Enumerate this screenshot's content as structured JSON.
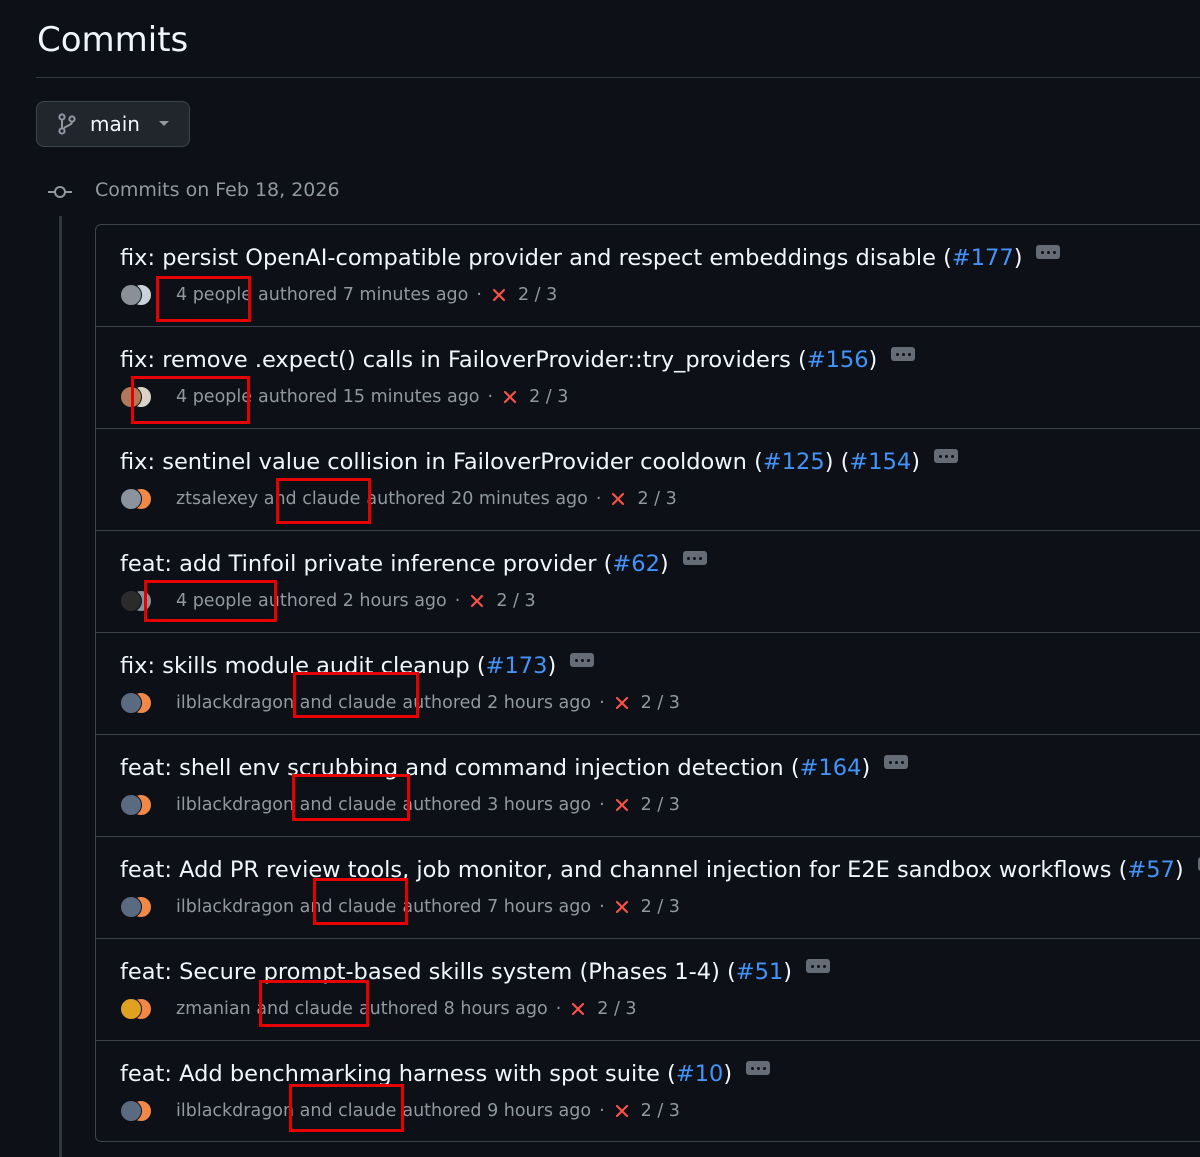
{
  "page": {
    "title": "Commits"
  },
  "branch": {
    "label": "main",
    "icon": "git-branch-icon"
  },
  "group": {
    "heading": "Commits on Feb 18, 2026"
  },
  "colors": {
    "background": "#0d1117",
    "link": "#4493f8",
    "muted": "#9198a1",
    "fail": "#f85149",
    "annotation": "#e60000"
  },
  "commits": [
    {
      "title_pre": "fix: persist OpenAI-compatible provider and respect embeddings disable (",
      "links": [
        "#177"
      ],
      "title_post": ")",
      "authors_text": "4 people",
      "authored": "authored 7 minutes ago",
      "status": "2 / 3"
    },
    {
      "title_pre": "fix: remove .expect() calls in FailoverProvider::try_providers (",
      "links": [
        "#156"
      ],
      "title_post": ")",
      "authors_text": "4 people",
      "authored": "authored 15 minutes ago",
      "status": "2 / 3"
    },
    {
      "title_pre": "fix: sentinel value collision in FailoverProvider cooldown (",
      "links": [
        "#125",
        "#154"
      ],
      "link_separator": ") (",
      "title_post": ")",
      "authors_text": "ztsalexey and claude",
      "authored": "authored 20 minutes ago",
      "status": "2 / 3"
    },
    {
      "title_pre": "feat: add Tinfoil private inference provider (",
      "links": [
        "#62"
      ],
      "title_post": ")",
      "authors_text": "4 people",
      "authored": "authored 2 hours ago",
      "status": "2 / 3"
    },
    {
      "title_pre": "fix: skills module audit cleanup (",
      "links": [
        "#173"
      ],
      "title_post": ")",
      "authors_text": "ilblackdragon and claude",
      "authored": "authored 2 hours ago",
      "status": "2 / 3"
    },
    {
      "title_pre": "feat: shell env scrubbing and command injection detection (",
      "links": [
        "#164"
      ],
      "title_post": ")",
      "authors_text": "ilblackdragon and claude",
      "authored": "authored 3 hours ago",
      "status": "2 / 3"
    },
    {
      "title_pre": "feat: Add PR review tools, job monitor, and channel injection for E2E sandbox workflows (",
      "links": [
        "#57"
      ],
      "title_post": ")",
      "authors_text": "ilblackdragon and claude",
      "authored": "authored 7 hours ago",
      "status": "2 / 3"
    },
    {
      "title_pre": "feat: Secure prompt-based skills system (Phases 1-4) (",
      "links": [
        "#51"
      ],
      "title_post": ")",
      "authors_text": "zmanian and claude",
      "authored": "authored 8 hours ago",
      "status": "2 / 3"
    },
    {
      "title_pre": "feat: Add benchmarking harness with spot suite (",
      "links": [
        "#10"
      ],
      "title_post": ")",
      "authors_text": "ilblackdragon and claude",
      "authored": "authored 9 hours ago",
      "status": "2 / 3"
    }
  ]
}
